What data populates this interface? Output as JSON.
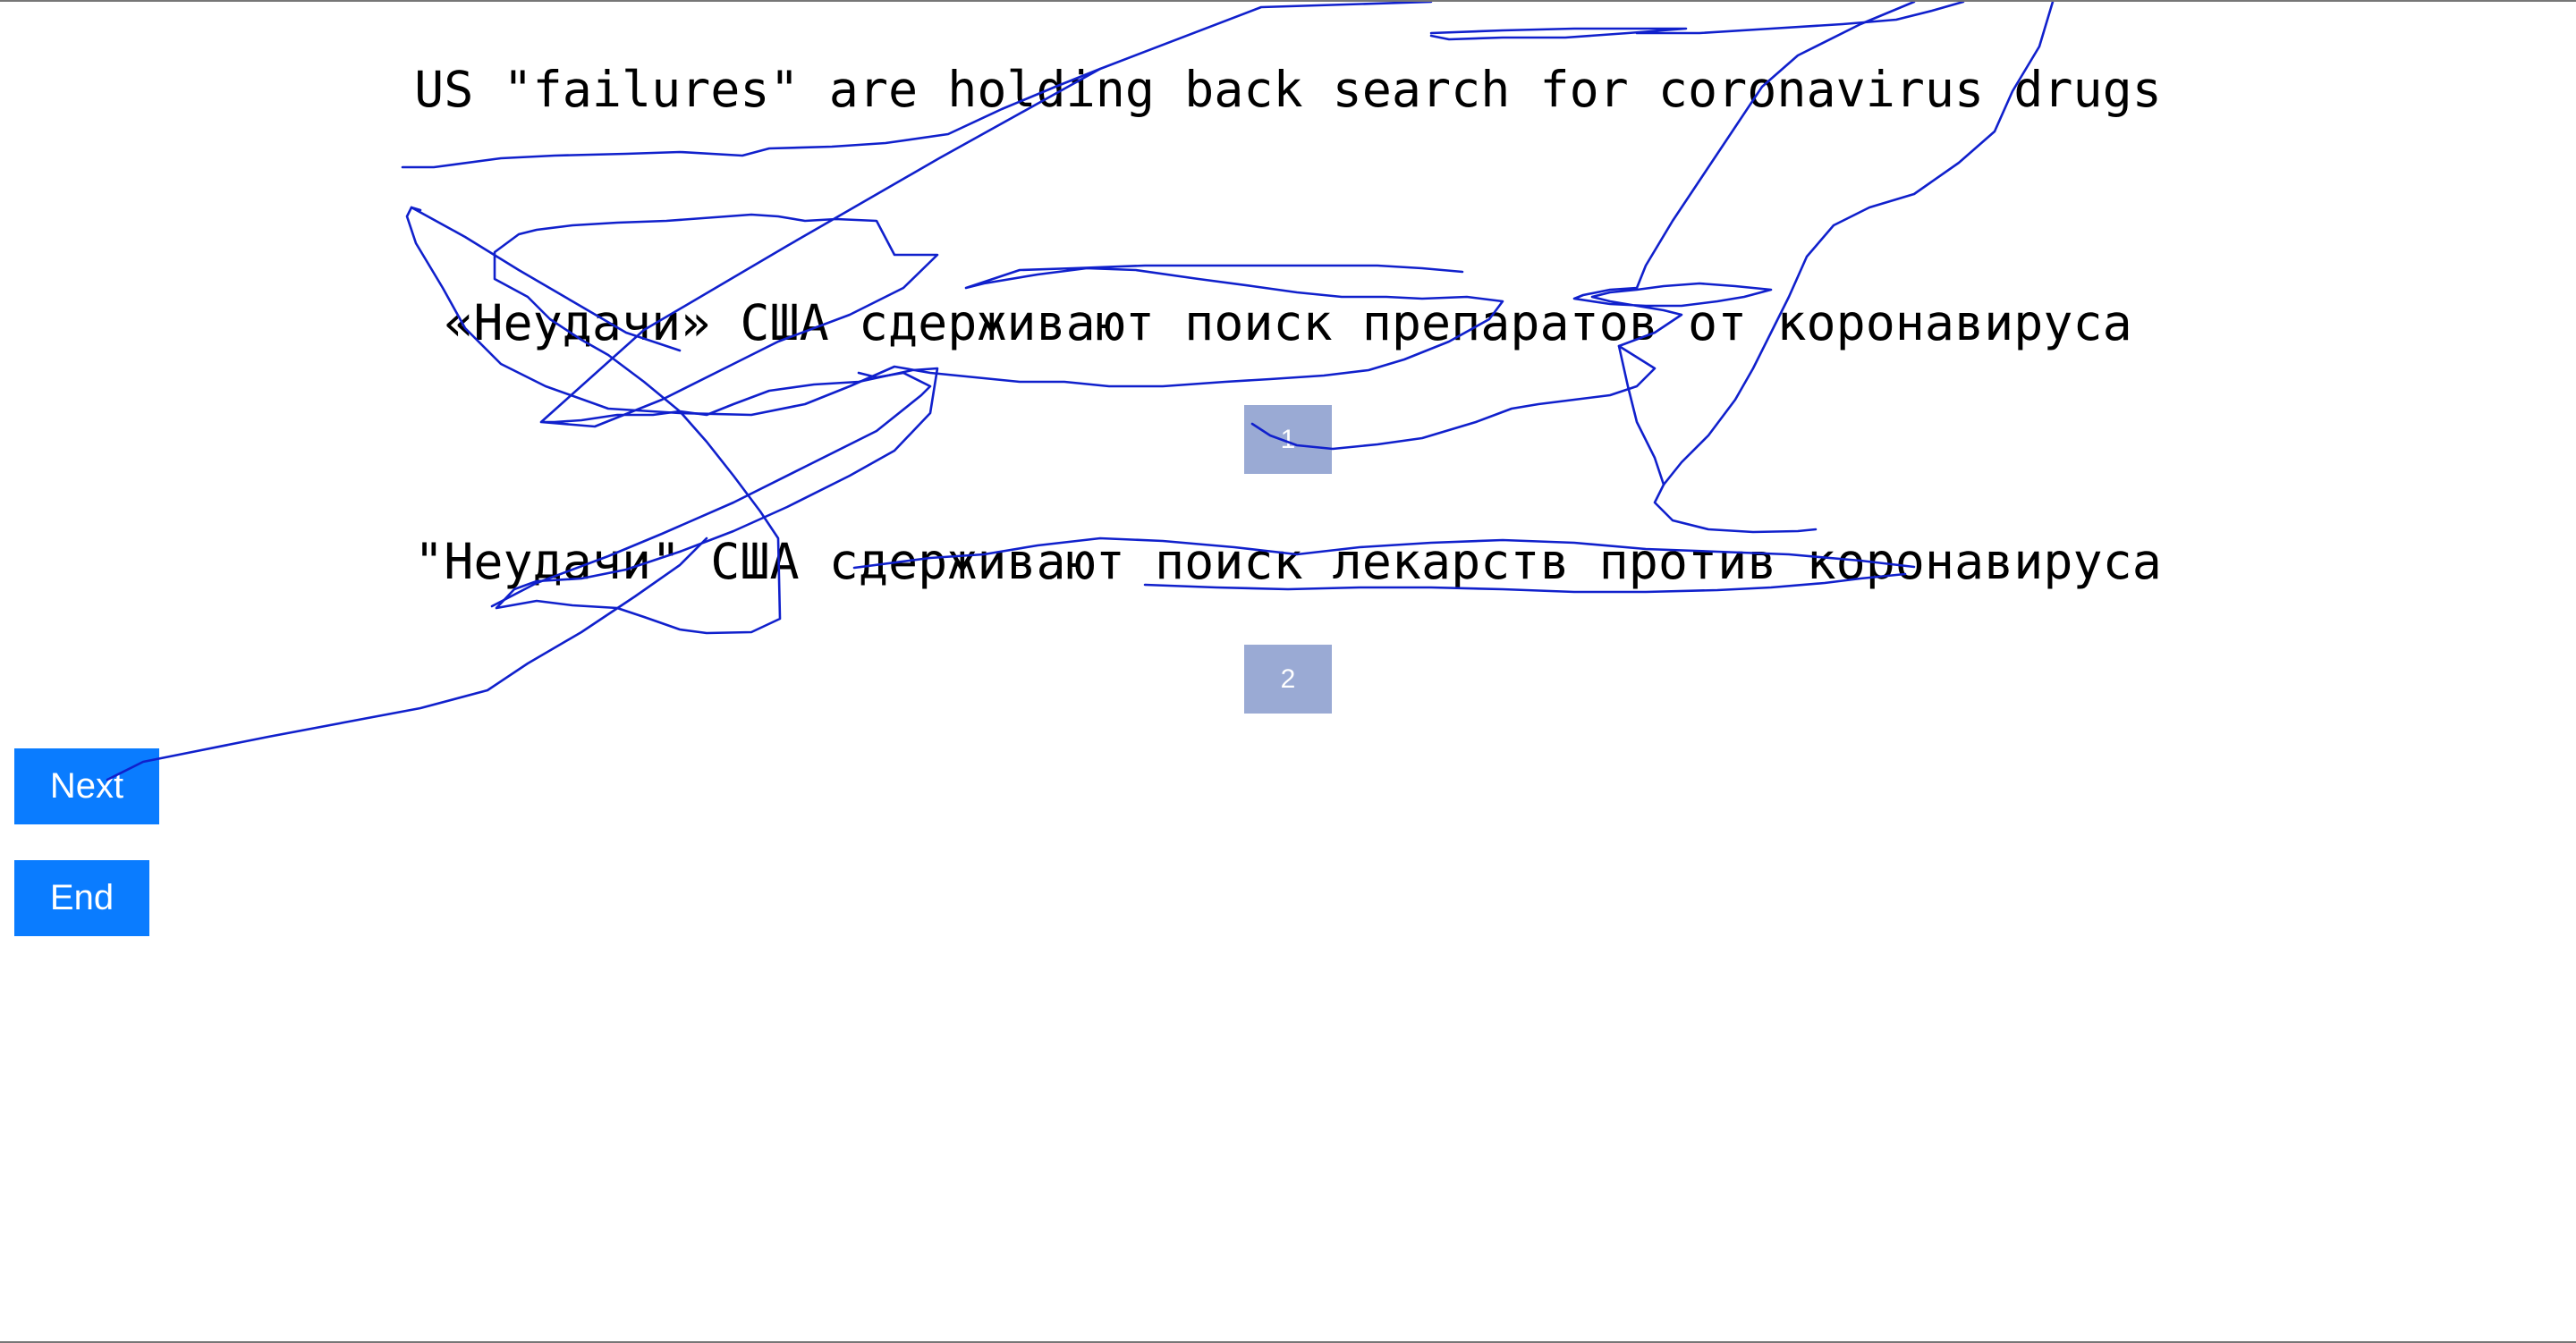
{
  "source_sentence": "US \"failures\" are holding back search for coronavirus drugs",
  "translations": [
    {
      "text": "«Неудачи» США сдерживают поиск препаратов от коронавируса",
      "choice_label": "1"
    },
    {
      "text": "\"Неудачи\" США сдерживают поиск лекарств против коронавируса",
      "choice_label": "2"
    }
  ],
  "buttons": {
    "next_label": "Next",
    "end_label": "End"
  },
  "colors": {
    "choice_button": "#9aaad4",
    "action_button": "#0a7cff",
    "scribble": "#1020cc"
  }
}
